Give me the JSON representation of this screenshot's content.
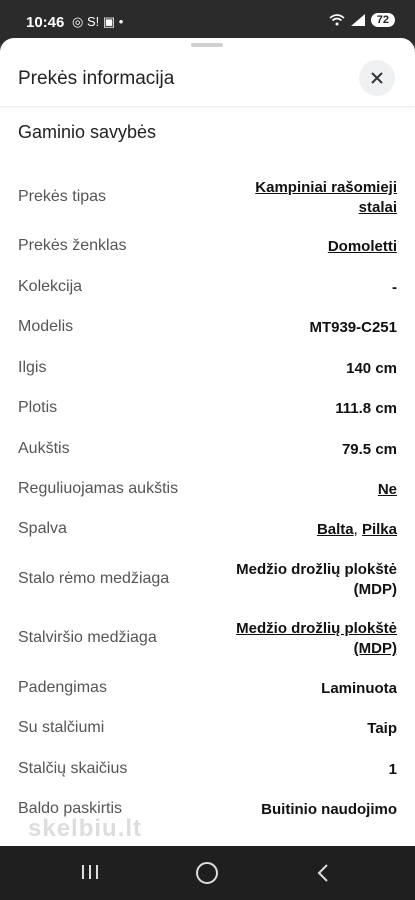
{
  "status": {
    "time": "10:46",
    "left_icons": "◎ S! ▣ •",
    "battery": "72"
  },
  "sheet": {
    "title": "Prekės informacija",
    "section_title": "Gaminio savybės",
    "rows": [
      {
        "label": "Prekės tipas",
        "value_line1": "Kampiniai rašomieji",
        "value_line2": "stalai"
      },
      {
        "label": "Prekės ženklas",
        "value": "Domoletti"
      },
      {
        "label": "Kolekcija",
        "value": "-"
      },
      {
        "label": "Modelis",
        "value": "MT939-C251"
      },
      {
        "label": "Ilgis",
        "value": "140 cm"
      },
      {
        "label": "Plotis",
        "value": "111.8 cm"
      },
      {
        "label": "Aukštis",
        "value": "79.5 cm"
      },
      {
        "label": "Reguliuojamas aukštis",
        "value": "Ne"
      },
      {
        "label": "Spalva",
        "value_a": "Balta",
        "sep": ", ",
        "value_b": "Pilka"
      },
      {
        "label": "Stalo rėmo medžiaga",
        "value_line1": "Medžio drožlių plokštė",
        "value_line2": "(MDP)"
      },
      {
        "label": "Stalviršio medžiaga",
        "value_line1": "Medžio drožlių plokštė",
        "value_line2": "(MDP)"
      },
      {
        "label": "Padengimas",
        "value": "Laminuota"
      },
      {
        "label": "Su stalčiumi",
        "value": "Taip"
      },
      {
        "label": "Stalčių skaičius",
        "value": "1"
      },
      {
        "label": "Baldo paskirtis",
        "value": "Buitinio naudojimo"
      }
    ]
  },
  "watermark": "skelbiu.lt"
}
